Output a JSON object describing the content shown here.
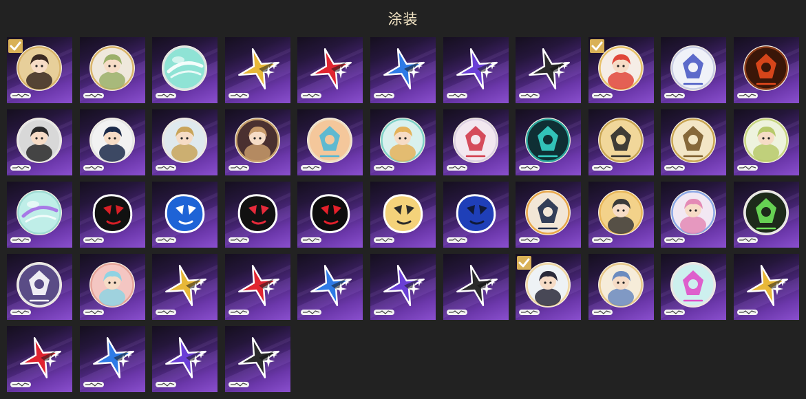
{
  "header": {
    "title": "涂装"
  },
  "items": [
    {
      "kind": "avatar",
      "base": "#e7cf9a",
      "accent": "#3a2a22",
      "ring": "#d9b46a",
      "selected": true
    },
    {
      "kind": "avatar",
      "base": "#efe8dc",
      "accent": "#9bb06a",
      "ring": "#d9b46a",
      "selected": false
    },
    {
      "kind": "orb",
      "base": "#8fe3d5",
      "accent": "#ffffff",
      "ring": "#d8e6e4",
      "selected": false
    },
    {
      "kind": "star",
      "base": "#e8b838",
      "accent": "#1b1b1b",
      "ring": "",
      "selected": false
    },
    {
      "kind": "star",
      "base": "#e02430",
      "accent": "#1b1b1b",
      "ring": "",
      "selected": false
    },
    {
      "kind": "star",
      "base": "#2f7be6",
      "accent": "#1b1b1b",
      "ring": "",
      "selected": false
    },
    {
      "kind": "star",
      "base": "#6a3fd6",
      "accent": "#1b1b1b",
      "ring": "",
      "selected": false
    },
    {
      "kind": "star",
      "base": "#2b2b2b",
      "accent": "#111111",
      "ring": "",
      "selected": false
    },
    {
      "kind": "avatar",
      "base": "#f5ede6",
      "accent": "#e0473a",
      "ring": "#e7c16a",
      "selected": true
    },
    {
      "kind": "emblem",
      "base": "#f0f2f8",
      "accent": "#4b5bc4",
      "ring": "#c9cde4",
      "selected": false
    },
    {
      "kind": "emblem",
      "base": "#3a1608",
      "accent": "#e84a1d",
      "ring": "#8a3a18",
      "selected": false
    },
    {
      "kind": "avatar",
      "base": "#d8d8d8",
      "accent": "#2a2a2a",
      "ring": "#e6e6e6",
      "selected": false
    },
    {
      "kind": "avatar",
      "base": "#f2f2f2",
      "accent": "#1c2a4a",
      "ring": "#e6e6e6",
      "selected": false
    },
    {
      "kind": "avatar",
      "base": "#dfe9ee",
      "accent": "#c9a45a",
      "ring": "#e6e6e6",
      "selected": false
    },
    {
      "kind": "avatar",
      "base": "#4a3030",
      "accent": "#c79a6a",
      "ring": "#c7a06a",
      "selected": false
    },
    {
      "kind": "emblem",
      "base": "#f4c79b",
      "accent": "#4fb7d6",
      "ring": "#f0ddc0",
      "selected": false
    },
    {
      "kind": "avatar",
      "base": "#d9f1ee",
      "accent": "#e4b35a",
      "ring": "#7fd2c8",
      "selected": false
    },
    {
      "kind": "emblem",
      "base": "#f3e8f0",
      "accent": "#d23a4a",
      "ring": "#dcd0e2",
      "selected": false
    },
    {
      "kind": "emblem",
      "base": "#0f2f34",
      "accent": "#36d3c8",
      "ring": "#2aa59c",
      "selected": false
    },
    {
      "kind": "emblem",
      "base": "#f1d79a",
      "accent": "#2b2b2b",
      "ring": "#c9a552",
      "selected": false
    },
    {
      "kind": "emblem",
      "base": "#f3e6c6",
      "accent": "#7a5a2a",
      "ring": "#c9a552",
      "selected": false
    },
    {
      "kind": "avatar",
      "base": "#eef3dd",
      "accent": "#b7c96a",
      "ring": "#c7d680",
      "selected": false
    },
    {
      "kind": "orb",
      "base": "#bfeee8",
      "accent": "#a46be6",
      "ring": "#9fdcd4",
      "selected": false
    },
    {
      "kind": "sticker",
      "base": "#111111",
      "accent": "#d81f26",
      "ring": "",
      "selected": false
    },
    {
      "kind": "sticker",
      "base": "#1e63d6",
      "accent": "#ffffff",
      "ring": "",
      "selected": false
    },
    {
      "kind": "sticker",
      "base": "#111111",
      "accent": "#e62a3a",
      "ring": "",
      "selected": false
    },
    {
      "kind": "sticker",
      "base": "#0d0d0d",
      "accent": "#e3202a",
      "ring": "",
      "selected": false
    },
    {
      "kind": "sticker",
      "base": "#f4d27a",
      "accent": "#2a2a2a",
      "ring": "",
      "selected": false
    },
    {
      "kind": "sticker",
      "base": "#1f3fb8",
      "accent": "#0f1a3a",
      "ring": "",
      "selected": false
    },
    {
      "kind": "emblem",
      "base": "#f2e6d6",
      "accent": "#1e2b4a",
      "ring": "#e9a74a",
      "selected": false
    },
    {
      "kind": "avatar",
      "base": "#f3d28a",
      "accent": "#3a3a3a",
      "ring": "#e9b85a",
      "selected": false
    },
    {
      "kind": "avatar",
      "base": "#f2e8f3",
      "accent": "#e48ab5",
      "ring": "#8aa7e6",
      "selected": false
    },
    {
      "kind": "emblem",
      "base": "#1d2a1a",
      "accent": "#6fe35a",
      "ring": "#e6e6e6",
      "selected": false
    },
    {
      "kind": "emblem",
      "base": "#5a4c86",
      "accent": "#ffffff",
      "ring": "#e6e6e6",
      "selected": false
    },
    {
      "kind": "avatar",
      "base": "#f4c6c2",
      "accent": "#8fd3e3",
      "ring": "#e7a59a",
      "selected": false
    },
    {
      "kind": "star",
      "base": "#e8b838",
      "accent": "#1b1b1b",
      "ring": "",
      "selected": false
    },
    {
      "kind": "star",
      "base": "#e02430",
      "accent": "#1b1b1b",
      "ring": "",
      "selected": false
    },
    {
      "kind": "star",
      "base": "#2f7be6",
      "accent": "#1b1b1b",
      "ring": "",
      "selected": false
    },
    {
      "kind": "star",
      "base": "#6a3fd6",
      "accent": "#1b1b1b",
      "ring": "",
      "selected": false
    },
    {
      "kind": "star",
      "base": "#2b2b2b",
      "accent": "#111111",
      "ring": "",
      "selected": false
    },
    {
      "kind": "avatar",
      "base": "#eef2f5",
      "accent": "#2a2a3a",
      "ring": "#f0d7a4",
      "selected": true
    },
    {
      "kind": "avatar",
      "base": "#f6ecd9",
      "accent": "#6b8bbf",
      "ring": "#e9c98a",
      "selected": false
    },
    {
      "kind": "emblem",
      "base": "#cdf0ee",
      "accent": "#e04fc8",
      "ring": "#e6e6e6",
      "selected": false
    },
    {
      "kind": "star",
      "base": "#e8b838",
      "accent": "#1b1b1b",
      "ring": "",
      "selected": false
    },
    {
      "kind": "star",
      "base": "#e02430",
      "accent": "#1b1b1b",
      "ring": "",
      "selected": false
    },
    {
      "kind": "star",
      "base": "#2f7be6",
      "accent": "#1b1b1b",
      "ring": "",
      "selected": false
    },
    {
      "kind": "star",
      "base": "#6a3fd6",
      "accent": "#1b1b1b",
      "ring": "",
      "selected": false
    },
    {
      "kind": "star",
      "base": "#2b2b2b",
      "accent": "#111111",
      "ring": "",
      "selected": false
    }
  ]
}
